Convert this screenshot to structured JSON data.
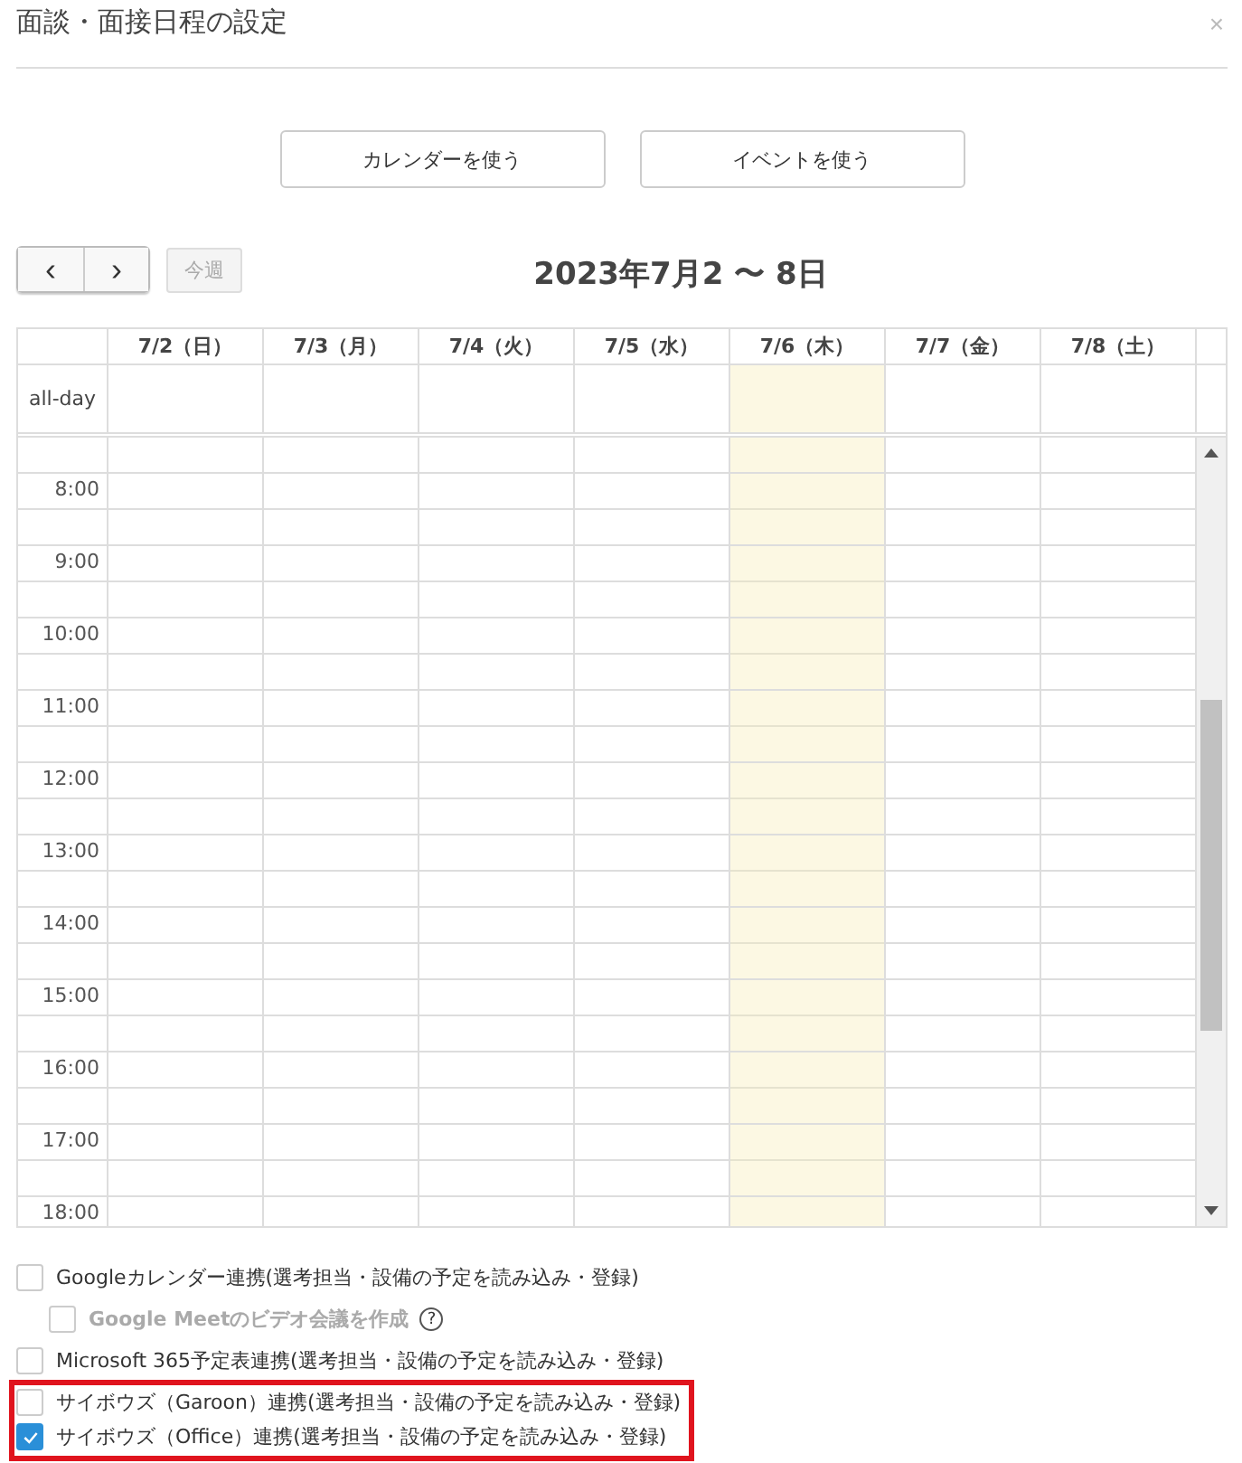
{
  "dialog": {
    "title": "面談・面接日程の設定",
    "close": "×"
  },
  "mode_buttons": [
    "カレンダーを使う",
    "イベントを使う"
  ],
  "nav": {
    "prev": "‹",
    "next": "›",
    "today": {
      "label": "今週",
      "disabled": true
    },
    "range": "2023年7月2 〜 8日"
  },
  "calendar": {
    "days": [
      {
        "label": "7/2（日）",
        "today": false
      },
      {
        "label": "7/3（月）",
        "today": false
      },
      {
        "label": "7/4（火）",
        "today": false
      },
      {
        "label": "7/5（水）",
        "today": false
      },
      {
        "label": "7/6（木）",
        "today": true
      },
      {
        "label": "7/7（金）",
        "today": false
      },
      {
        "label": "7/8（土）",
        "today": false
      }
    ],
    "all_day_label": "all-day",
    "hours": [
      "8:00",
      "9:00",
      "10:00",
      "11:00",
      "12:00",
      "13:00",
      "14:00",
      "15:00",
      "16:00",
      "17:00",
      "18:00"
    ]
  },
  "option_groups": [
    {
      "highlighted": false,
      "options": [
        {
          "label": "Googleカレンダー連携(選考担当・設備の予定を読み込み・登録)",
          "checked": false,
          "disabled": false,
          "children": [
            {
              "label": "Google Meetのビデオ会議を作成",
              "checked": false,
              "disabled": true,
              "help": "?"
            }
          ]
        },
        {
          "label": "Microsoft 365予定表連携(選考担当・設備の予定を読み込み・登録)",
          "checked": false,
          "disabled": false
        }
      ]
    },
    {
      "highlighted": true,
      "options": [
        {
          "label": "サイボウズ（Garoon）連携(選考担当・設備の予定を読み込み・登録)",
          "checked": false,
          "disabled": false
        },
        {
          "label": "サイボウズ（Office）連携(選考担当・設備の予定を読み込み・登録)",
          "checked": true,
          "disabled": false
        }
      ]
    }
  ]
}
